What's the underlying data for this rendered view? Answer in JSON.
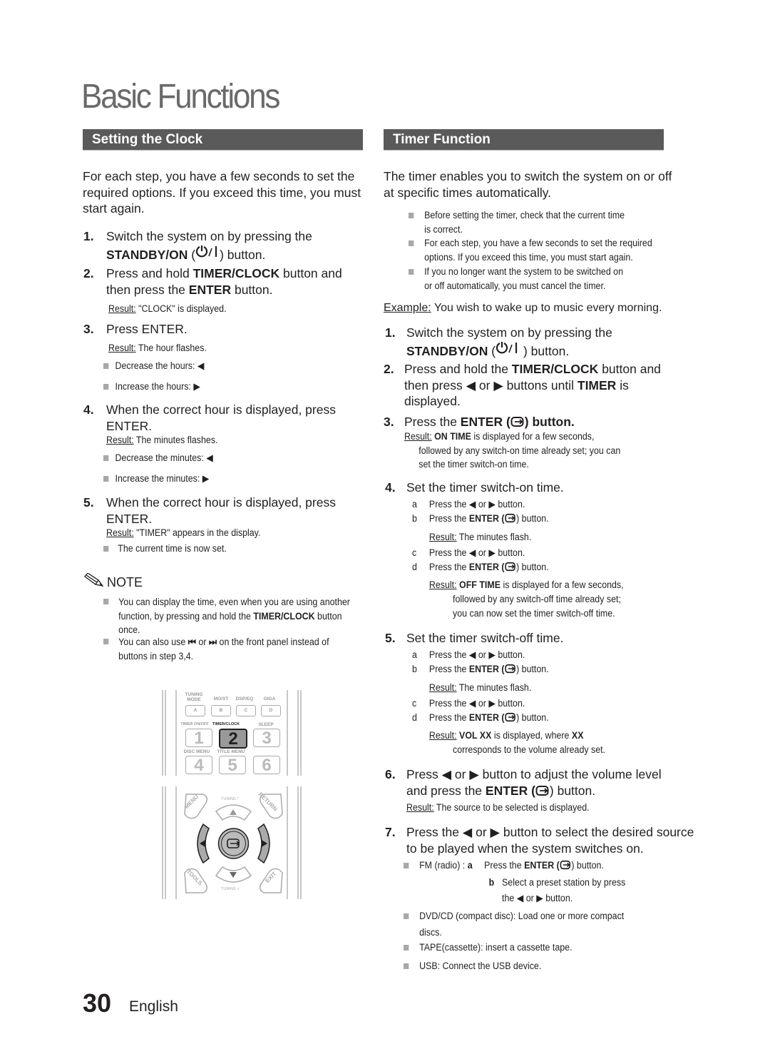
{
  "page": {
    "title": "Basic Functions",
    "page_number": "30",
    "language": "English"
  },
  "left": {
    "section_title": "Setting the Clock",
    "intro": [
      "For each step, you have a few seconds to set the",
      "required options. If you exceed this time, you must",
      "start again."
    ],
    "steps": [
      {
        "num": "1.",
        "line1": "Switch the system on by pressing the",
        "bold2": "STANDBY/ON",
        "line2_open": " (",
        "line2_close": ") button."
      },
      {
        "num": "2.",
        "pre": "Press and hold ",
        "bold": "TIMER/CLOCK",
        "post": " button and",
        "line2_pre": "then press the ",
        "line2_bold": "ENTER",
        "line2_post": " button.",
        "result_label": "Result:",
        "result": " \"CLOCK\" is displayed."
      },
      {
        "num": "3.",
        "text": "Press ENTER.",
        "result_label": "Result:",
        "result": " The hour flashes.",
        "bullets": [
          "Decrease the hours: ◀",
          "Increase the hours: ▶"
        ]
      },
      {
        "num": "4.",
        "line1": "When the correct hour is displayed, press",
        "line2": "ENTER.",
        "result_label": "Result:",
        "result": " The minutes flashes.",
        "bullets": [
          "Decrease the minutes: ◀",
          "Increase the minutes: ▶"
        ]
      },
      {
        "num": "5.",
        "line1": "When the correct hour is displayed, press",
        "line2": "ENTER.",
        "result_label": "Result:",
        "result": " \"TIMER\" appears in the display.",
        "bullets": [
          "The current time is now set."
        ]
      }
    ],
    "note": {
      "label": "NOTE",
      "items": [
        {
          "l1": "You can display the time, even when you are using another",
          "l2_pre": "function, by pressing and hold the ",
          "l2_bold": "TIMER/CLOCK",
          "l2_post": " button",
          "l3": "once."
        },
        {
          "l1_pre": "You can also use ",
          "l1_icon1": "⏮",
          "l1_mid": " or ",
          "l1_icon2": "⏭",
          "l1_post": " on the front panel instead of",
          "l2": "buttons in step 3,4."
        }
      ]
    },
    "remote": {
      "row_labels_1": [
        "TUNING MODE",
        "MO/ST",
        "DSP/EQ",
        "GIGA"
      ],
      "row_keys_1": [
        "A",
        "B",
        "C",
        "D"
      ],
      "row_labels_2": [
        "TIMER ON/OFF",
        "TIMER/CLOCK",
        "SLEEP"
      ],
      "row_keys_2": [
        "1",
        "2",
        "3"
      ],
      "row_labels_3": [
        "DISC MENU",
        "TITLE MENU",
        ""
      ],
      "row_keys_3": [
        "4",
        "5",
        "6"
      ],
      "nav": {
        "menu": "MENU",
        "return": "RETURN",
        "tools": "TOOLS",
        "exit": "EXIT",
        "tuning_up": "TUNING ^",
        "tuning_down": "TUNING ˅"
      }
    }
  },
  "right": {
    "section_title": "Timer Function",
    "intro": [
      "The timer enables you to switch the system on or off",
      "at specific times automatically."
    ],
    "bullets": [
      [
        "Before setting the timer, check that the current time",
        "is correct."
      ],
      [
        "For each step, you have a few seconds to set the required",
        "options. If you exceed this time, you must start again."
      ],
      [
        "If you no longer want the system to be switched on",
        "or off automatically, you must cancel the timer."
      ]
    ],
    "example_label": "Example:",
    "example": " You wish to wake up to music every morning.",
    "steps": {
      "s1": {
        "num": "1.",
        "line1": "Switch the system on by pressing the",
        "bold": "STANDBY/ON",
        "open": " (",
        "close": " ) button."
      },
      "s2": {
        "num": "2.",
        "pre": "Press and hold the ",
        "bold": "TIMER/CLOCK",
        "post": " button and",
        "l2_pre": "then press ◀ or ▶ buttons until ",
        "l2_bold": "TIMER",
        "l2_post": " is",
        "l3": "displayed."
      },
      "s3": {
        "num": "3.",
        "pre": "Press the ",
        "bold": "ENTER (",
        "post": ") button.",
        "result_label": "Result:",
        "result_bold": " ON TIME",
        "result": " is displayed for a few seconds,",
        "r2": "followed by any switch-on time already set; you can",
        "r3": "set the timer switch-on time."
      },
      "s4": {
        "num": "4.",
        "text": "Set the timer switch-on time.",
        "a": {
          "l": "a",
          "t": "Press the ◀ or ▶ button."
        },
        "b": {
          "l": "b",
          "pre": "Press the ",
          "bold": "ENTER (",
          "post": ") button.",
          "result_label": "Result:",
          "result": " The minutes flash."
        },
        "c": {
          "l": "c",
          "t": "Press the ◀ or ▶ button."
        },
        "d": {
          "l": "d",
          "pre": "Press the ",
          "bold": "ENTER (",
          "post": ") button.",
          "result_label": "Result:",
          "result_bold": " OFF TIME",
          "result": " is displayed for a few seconds,",
          "r2": "followed by any switch-off time already set;",
          "r3": "you can now set the timer switch-off time."
        }
      },
      "s5": {
        "num": "5.",
        "text": "Set the timer switch-off time.",
        "a": {
          "l": "a",
          "t": "Press the ◀ or ▶ button."
        },
        "b": {
          "l": "b",
          "pre": "Press the ",
          "bold": "ENTER (",
          "post": ") button.",
          "result_label": "Result:",
          "result": " The minutes flash."
        },
        "c": {
          "l": "c",
          "t": "Press the  ◀ or ▶ button."
        },
        "d": {
          "l": "d",
          "pre": "Press the ",
          "bold": "ENTER (",
          "post": ") button.",
          "result_label": "Result:",
          "result_bold": " VOL XX",
          "result": " is displayed, where ",
          "result_bold2": "XX",
          "r2": "corresponds to the volume already set."
        }
      },
      "s6": {
        "num": "6.",
        "line1": "Press ◀ or ▶ button to adjust the volume level",
        "l2_pre": "and press the ",
        "l2_bold": "ENTER (",
        "l2_post": ") button.",
        "result_label": "Result:",
        "result": " The source to be selected is displayed."
      },
      "s7": {
        "num": "7.",
        "line1": "Press the ◀ or ▶ button to select the desired source",
        "line2": "to be played when the system switches on.",
        "fm_pre": "FM (radio) : ",
        "fm_a": "a",
        "fm_a_pre": "Press the ",
        "fm_a_bold": "ENTER (",
        "fm_a_post": ") button.",
        "fm_b": "b",
        "fm_b_l1": "Select a preset station by press",
        "fm_b_l2": "the  ◀ or ▶ button.",
        "others": [
          [
            "DVD/CD (compact disc): Load one or more compact",
            "discs."
          ],
          [
            "TAPE(cassette): insert a cassette tape."
          ],
          [
            "USB: Connect the USB device."
          ]
        ]
      }
    }
  }
}
